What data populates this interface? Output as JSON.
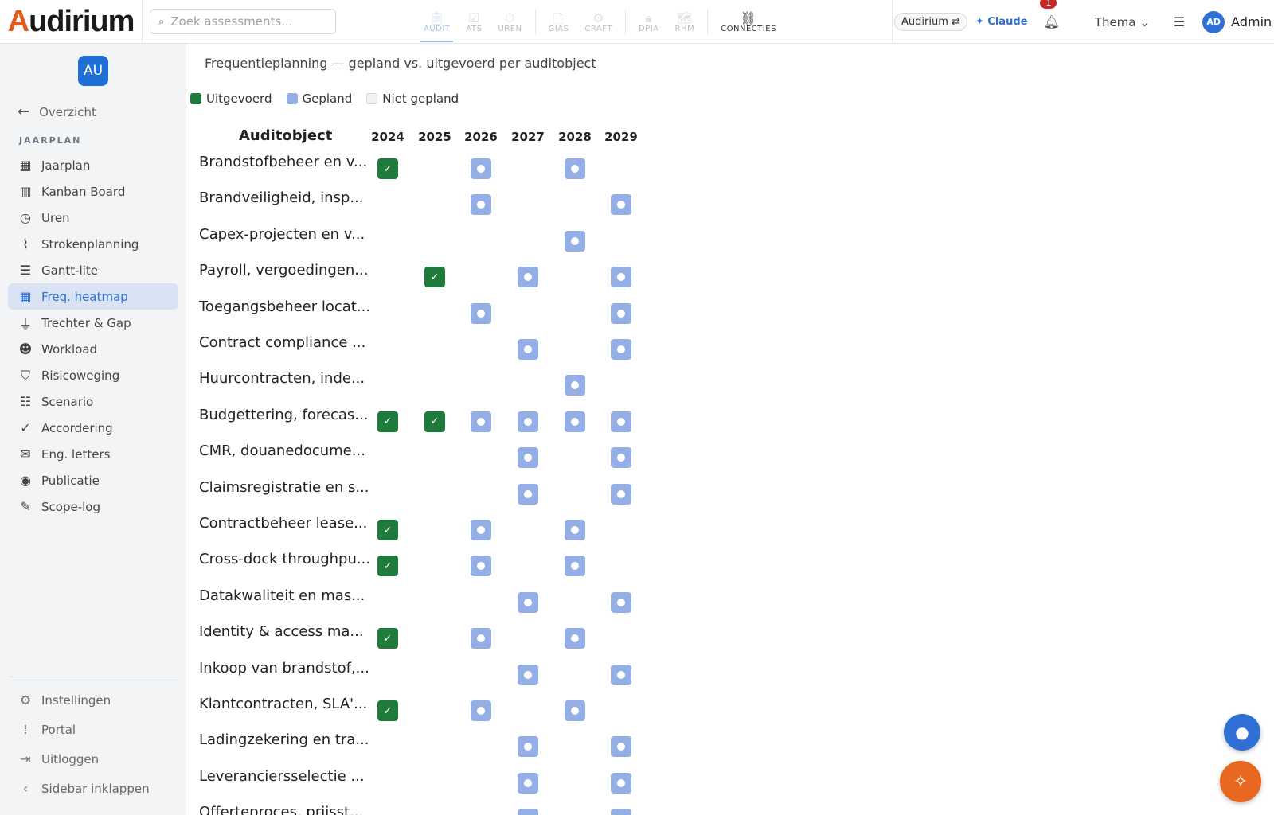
{
  "app": {
    "logo_first": "A",
    "logo_rest": "udirium"
  },
  "search": {
    "placeholder": "Zoek assessments..."
  },
  "modules": [
    {
      "label": "AUDIT",
      "icon": "clipboard-icon"
    },
    {
      "label": "ATS",
      "icon": "checkbox-icon"
    },
    {
      "label": "UREN",
      "icon": "stopwatch-icon"
    },
    {
      "label": "GIAS",
      "icon": "document-icon"
    },
    {
      "label": "CRAFT",
      "icon": "gear-icon"
    },
    {
      "label": "DPIA",
      "icon": "lock-icon"
    },
    {
      "label": "RHM",
      "icon": "map-icon"
    },
    {
      "label": "CONNECTIES",
      "icon": "network-icon"
    }
  ],
  "header": {
    "tenant": "Audirium ⇄",
    "claude": "✦ Claude",
    "notifications": "1",
    "thema": "Thema ⌄",
    "avatar": "AD",
    "user": "Admin"
  },
  "sidebar": {
    "badge": "AU",
    "back": "Overzicht",
    "section": "JAARPLAN",
    "items": [
      {
        "label": "Jaarplan",
        "icon": "calendar-check-icon"
      },
      {
        "label": "Kanban Board",
        "icon": "kanban-icon"
      },
      {
        "label": "Uren",
        "icon": "clock-icon"
      },
      {
        "label": "Strokenplanning",
        "icon": "chart-steps-icon"
      },
      {
        "label": "Gantt-lite",
        "icon": "gantt-icon"
      },
      {
        "label": "Freq. heatmap",
        "icon": "grid-icon"
      },
      {
        "label": "Trechter & Gap",
        "icon": "funnel-icon"
      },
      {
        "label": "Workload",
        "icon": "users-icon"
      },
      {
        "label": "Risicoweging",
        "icon": "shield-icon"
      },
      {
        "label": "Scenario",
        "icon": "sliders-icon"
      },
      {
        "label": "Accordering",
        "icon": "double-check-icon"
      },
      {
        "label": "Eng. letters",
        "icon": "envelope-icon"
      },
      {
        "label": "Publicatie",
        "icon": "eye-icon"
      },
      {
        "label": "Scope-log",
        "icon": "edit-icon"
      }
    ],
    "bottom": [
      {
        "label": "Instellingen",
        "icon": "gear-icon"
      },
      {
        "label": "Portal",
        "icon": "apps-icon"
      },
      {
        "label": "Uitloggen",
        "icon": "logout-icon"
      },
      {
        "label": "Sidebar inklappen",
        "icon": "chevron-left-icon"
      }
    ]
  },
  "main": {
    "title": "Frequentieplanning — gepland vs. uitgevoerd per auditobject",
    "legend": [
      {
        "label": "Uitgevoerd",
        "color": "#1e7b3c"
      },
      {
        "label": "Gepland",
        "color": "#94afe6"
      },
      {
        "label": "Niet gepland",
        "color": "#f0f1f3"
      }
    ],
    "col_object": "Auditobject",
    "years": [
      "2024",
      "2025",
      "2026",
      "2027",
      "2028",
      "2029"
    ],
    "rows": [
      {
        "label": "Brandstofbeheer en v...",
        "cells": [
          "done",
          "",
          "plan",
          "",
          "plan",
          ""
        ]
      },
      {
        "label": "Brandveiligheid, insp...",
        "cells": [
          "",
          "",
          "plan",
          "",
          "",
          "plan"
        ]
      },
      {
        "label": "Capex-projecten en v...",
        "cells": [
          "",
          "",
          "",
          "",
          "plan",
          ""
        ]
      },
      {
        "label": "Payroll, vergoedingen...",
        "cells": [
          "",
          "done",
          "",
          "plan",
          "",
          "plan"
        ]
      },
      {
        "label": "Toegangsbeheer locat...",
        "cells": [
          "",
          "",
          "plan",
          "",
          "",
          "plan"
        ]
      },
      {
        "label": "Contract compliance ...",
        "cells": [
          "",
          "",
          "",
          "plan",
          "",
          "plan"
        ]
      },
      {
        "label": "Huurcontracten, inde...",
        "cells": [
          "",
          "",
          "",
          "",
          "plan",
          ""
        ]
      },
      {
        "label": "Budgettering, forecas...",
        "cells": [
          "done",
          "done",
          "plan",
          "plan",
          "plan",
          "plan"
        ]
      },
      {
        "label": "CMR, douanedocume...",
        "cells": [
          "",
          "",
          "",
          "plan",
          "",
          "plan"
        ]
      },
      {
        "label": "Claimsregistratie en s...",
        "cells": [
          "",
          "",
          "",
          "plan",
          "",
          "plan"
        ]
      },
      {
        "label": "Contractbeheer lease...",
        "cells": [
          "done",
          "",
          "plan",
          "",
          "plan",
          ""
        ]
      },
      {
        "label": "Cross-dock throughpu...",
        "cells": [
          "done",
          "",
          "plan",
          "",
          "plan",
          ""
        ]
      },
      {
        "label": "Datakwaliteit en mas...",
        "cells": [
          "",
          "",
          "",
          "plan",
          "",
          "plan"
        ]
      },
      {
        "label": "Identity & access ma...",
        "cells": [
          "done",
          "",
          "plan",
          "",
          "plan",
          ""
        ]
      },
      {
        "label": "Inkoop van brandstof,...",
        "cells": [
          "",
          "",
          "",
          "plan",
          "",
          "plan"
        ]
      },
      {
        "label": "Klantcontracten, SLA'...",
        "cells": [
          "done",
          "",
          "plan",
          "",
          "plan",
          ""
        ]
      },
      {
        "label": "Ladingzekering en tra...",
        "cells": [
          "",
          "",
          "",
          "plan",
          "",
          "plan"
        ]
      },
      {
        "label": "Leveranciersselectie ...",
        "cells": [
          "",
          "",
          "",
          "plan",
          "",
          "plan"
        ]
      },
      {
        "label": "Offerteproces, prijsst...",
        "cells": [
          "",
          "",
          "",
          "plan",
          "",
          "plan"
        ]
      }
    ]
  }
}
